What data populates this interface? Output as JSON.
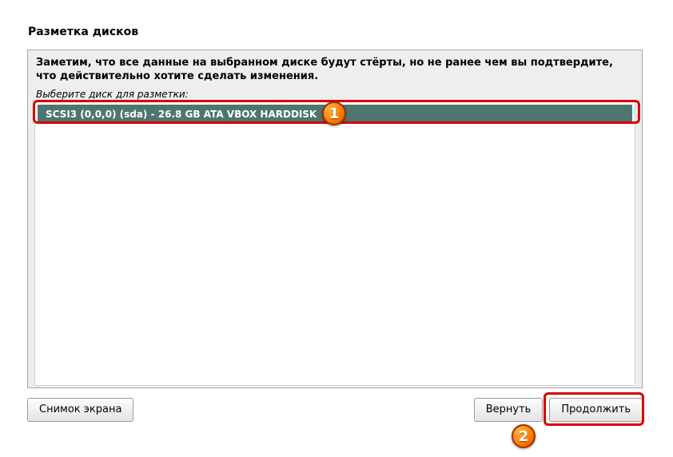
{
  "title": "Разметка дисков",
  "description": "Заметим, что все данные на выбранном диске будут стёрты, но не ранее чем вы подтвердите, что действительно хотите сделать изменения.",
  "prompt": "Выберите диск для разметки:",
  "disks": [
    {
      "label": "SCSI3 (0,0,0) (sda) - 26.8 GB ATA VBOX HARDDISK"
    }
  ],
  "buttons": {
    "screenshot": "Снимок экрана",
    "back": "Вернуть",
    "continue": "Продолжить"
  },
  "annotations": {
    "badge1": "1",
    "badge2": "2"
  }
}
